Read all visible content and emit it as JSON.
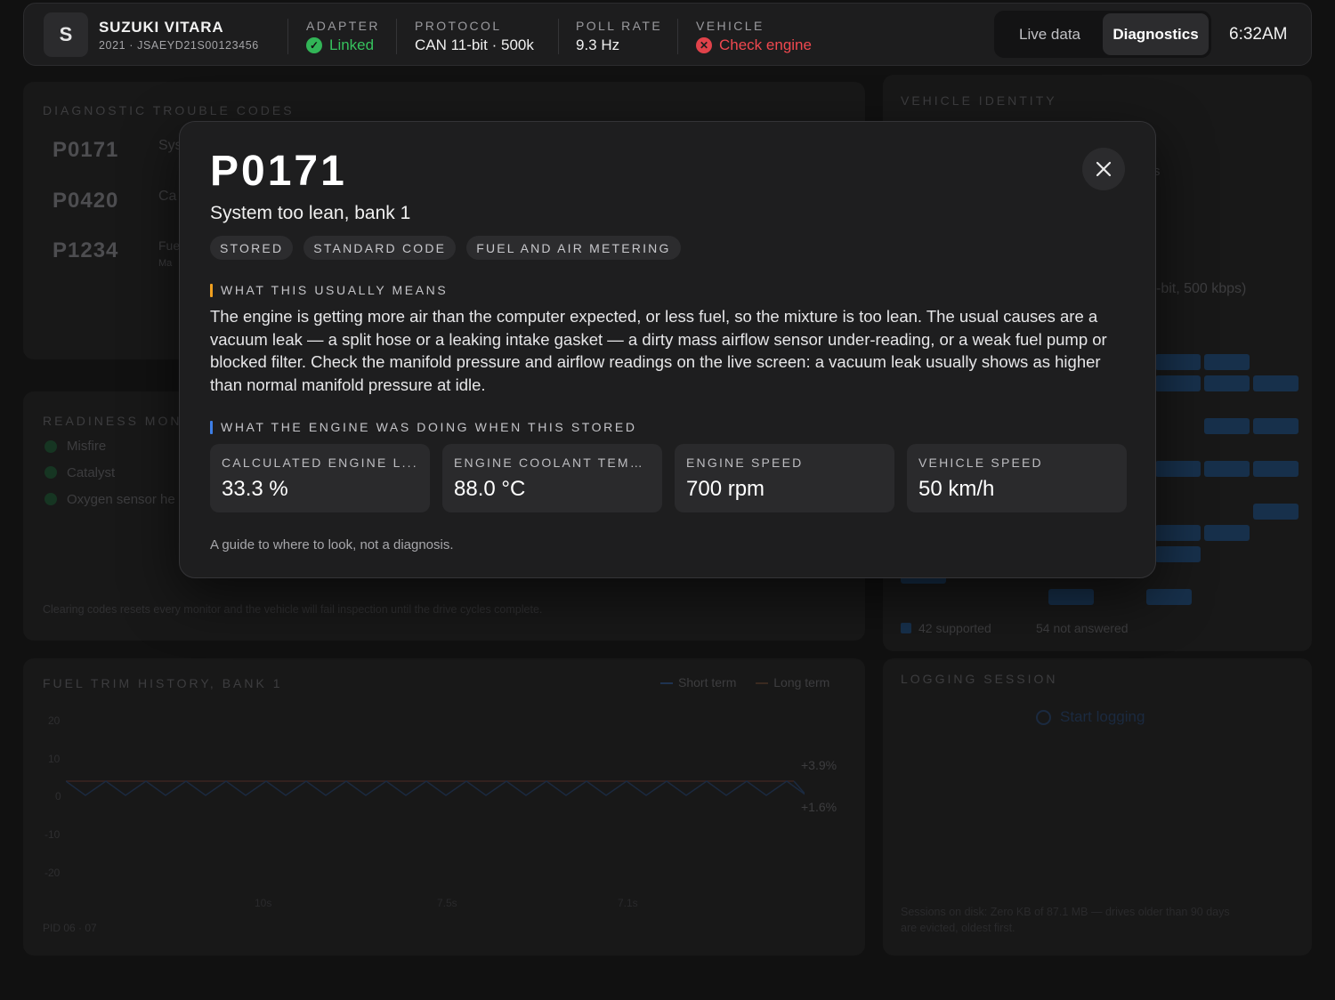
{
  "header": {
    "logo_letter": "S",
    "vehicle_name": "SUZUKI VITARA",
    "vehicle_sub": "2021 · JSAEYD21S00123456",
    "adapter_label": "ADAPTER",
    "adapter_value": "Linked",
    "protocol_label": "PROTOCOL",
    "protocol_value": "CAN 11-bit · 500k",
    "poll_label": "POLL RATE",
    "poll_value": "9.3 Hz",
    "vehicle_label": "VEHICLE",
    "vehicle_value": "Check engine",
    "tabs": [
      "Live data",
      "Diagnostics"
    ],
    "active_tab": "Diagnostics",
    "time": "6:32AM"
  },
  "background": {
    "dtc_title": "DIAGNOSTIC TROUBLE CODES",
    "dtc_codes": [
      "P0171",
      "P0420",
      "P1234"
    ],
    "dtc_desc_fragments": [
      "Sys",
      "Ca",
      "Fue",
      "Ma"
    ],
    "readiness_title": "READINESS MONI",
    "monitors": [
      "Misfire",
      "Catalyst",
      "Oxygen sensor he"
    ],
    "clear_note": "Clearing codes resets every monitor and the vehicle will fail inspection until the drive cycles complete.",
    "fuel_title": "FUEL TRIM HISTORY, BANK 1",
    "legend_short": "Short term",
    "legend_long": "Long term",
    "y_ticks": [
      "20",
      "10",
      "0",
      "-10",
      "-20"
    ],
    "x_ticks": [
      "10s",
      "7.5s",
      "7.1s"
    ],
    "pid_range": "PID 06 · 07",
    "short_term_value": "+3.9%",
    "long_term_value": "+1.6%",
    "identity_title": "VEHICLE IDENTITY",
    "identity_fragment_1": "s",
    "identity_fragment_2": "-bit, 500 kbps)",
    "pid_supported": "42 supported",
    "pid_not_answered": "54 not answered",
    "logging_title": "LOGGING SESSION",
    "start_logging": "Start logging",
    "sessions_note_1": "Sessions on disk: Zero KB of 87.1 MB — drives older than 90 days",
    "sessions_note_2": "are evicted, oldest first."
  },
  "modal": {
    "code": "P0171",
    "title": "System too lean, bank 1",
    "chips": [
      "STORED",
      "STANDARD CODE",
      "FUEL AND AIR METERING"
    ],
    "meaning_heading": "WHAT THIS USUALLY MEANS",
    "meaning_body": "The engine is getting more air than the computer expected, or less fuel, so the mixture is too lean. The usual causes are a vacuum leak — a split hose or a leaking intake gasket — a dirty mass airflow sensor under-reading, or a weak fuel pump or blocked filter. Check the manifold pressure and airflow readings on the live screen: a vacuum leak usually shows as higher than normal manifold pressure at idle.",
    "freeze_heading": "WHAT THE ENGINE WAS DOING WHEN THIS STORED",
    "freeze_frame": [
      {
        "label": "CALCULATED ENGINE L...",
        "value": "33.3 %"
      },
      {
        "label": "ENGINE COOLANT TEMP...",
        "value": "88.0 °C"
      },
      {
        "label": "ENGINE SPEED",
        "value": "700 rpm"
      },
      {
        "label": "VEHICLE SPEED",
        "value": "50 km/h"
      }
    ],
    "footnote": "A guide to where to look, not a diagnosis."
  },
  "colors": {
    "ok": "#32b557",
    "error": "#e0424a",
    "accent_amber": "#f0a020",
    "accent_blue": "#3d7ee6"
  },
  "icons": {
    "adapter_status": "check-circle-icon",
    "vehicle_status": "error-circle-icon",
    "close": "close-icon",
    "start_logging": "record-icon"
  }
}
